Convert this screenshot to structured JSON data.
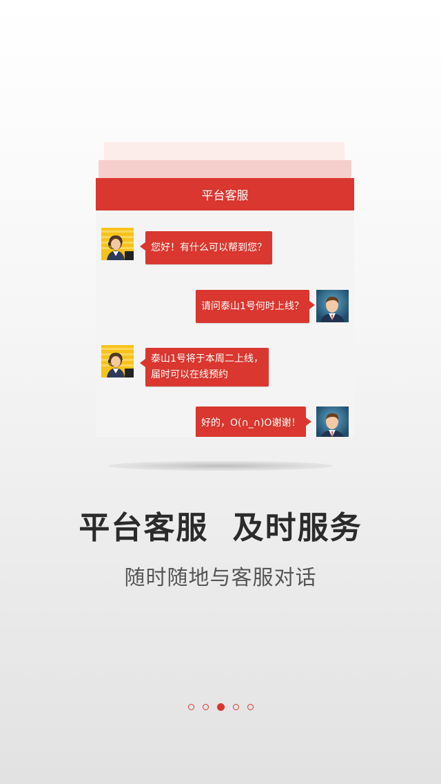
{
  "card": {
    "header_title": "平台客服"
  },
  "messages": [
    {
      "side": "left",
      "sender": "agent",
      "text": [
        "您好！有什么可以帮到您？"
      ]
    },
    {
      "side": "right",
      "sender": "user",
      "text": [
        "请问泰山1号何时上线？"
      ]
    },
    {
      "side": "left",
      "sender": "agent",
      "text": [
        "泰山1号将于本周二上线，",
        "届时可以在线预约"
      ]
    },
    {
      "side": "right",
      "sender": "user",
      "text": [
        "好的，O(∩_∩)O谢谢！"
      ]
    }
  ],
  "headline": "平台客服  及时服务",
  "subline": "随时随地与客服对话",
  "pagination": {
    "total": 5,
    "current": 3
  },
  "colors": {
    "accent": "#d9372f",
    "headline": "#2b2b2b",
    "subline": "#555555"
  },
  "icons": {
    "agent_avatar": "customer-service-agent-icon",
    "user_avatar": "business-man-icon"
  }
}
